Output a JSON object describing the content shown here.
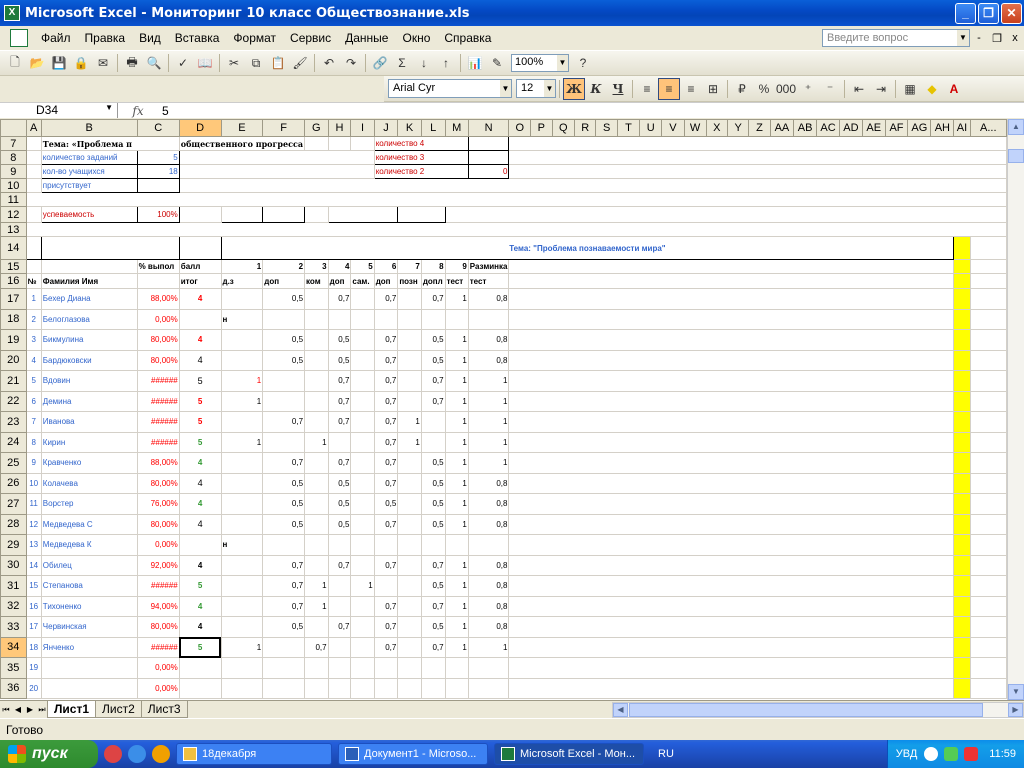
{
  "window": {
    "title": "Microsoft Excel - Мониторинг 10 класс Обществознание.xls",
    "app_icon": "excel-icon",
    "minimize": "_",
    "restore": "❐",
    "close": "✕"
  },
  "menu": {
    "items": [
      "Файл",
      "Правка",
      "Вид",
      "Вставка",
      "Формат",
      "Сервис",
      "Данные",
      "Окно",
      "Справка"
    ],
    "ask_placeholder": "Введите вопрос",
    "mdi_minimize": "-",
    "mdi_restore": "❐",
    "mdi_close": "x"
  },
  "toolbar": {
    "zoom": "100%"
  },
  "format_toolbar": {
    "font": "Arial Cyr",
    "size": "12",
    "bold": "Ж",
    "italic": "К",
    "underline": "Ч",
    "percent": "%",
    "thousands": "000"
  },
  "formula_bar": {
    "cell": "D34",
    "fx": "fx",
    "value": "5"
  },
  "columns": [
    "A",
    "B",
    "C",
    "D",
    "E",
    "F",
    "G",
    "H",
    "I",
    "J",
    "K",
    "L",
    "M",
    "N",
    "O",
    "P",
    "Q",
    "R",
    "S",
    "T",
    "U",
    "V",
    "W",
    "X",
    "Y",
    "Z",
    "AA",
    "AB",
    "AC",
    "AD",
    "AE",
    "AF",
    "AG",
    "AH",
    "AI",
    "A..."
  ],
  "sheet": {
    "topic_label": "Тема: «Проблема п",
    "topic_label_cont": "общественного прогресса",
    "tasks_label": "количество заданий",
    "tasks_value": "5",
    "students_label": "кол-во учащихся",
    "students_value": "18",
    "present_label": "присутствует",
    "count4_label": "количество 4",
    "count3_label": "количество 3",
    "count2_label": "количество 2",
    "count2_value": "0",
    "progress_label": "успеваемость",
    "progress_value": "100%",
    "theme_title": "Тема: \"Проблема познаваемости мира\"",
    "pct_header": "% выпол",
    "score_header": "балл",
    "task_numbers": [
      "1",
      "2",
      "3",
      "4",
      "5",
      "6",
      "7",
      "8",
      "9"
    ],
    "warmup": "Разминка",
    "num_header": "№",
    "name_header": "Фамилия  Имя",
    "total_header": "итог",
    "subheaders": [
      "д.з",
      "доп",
      "ком",
      "доп",
      "сам.",
      "доп",
      "позн",
      "допл",
      "тест",
      "тест"
    ]
  },
  "students": [
    {
      "row": "17",
      "n": "1",
      "name": "Бехер Диана",
      "pct": "88,00%",
      "grade": "4",
      "gclass": "g4",
      "e": "",
      "f": "0,5",
      "g": "",
      "h": "0,7",
      "i": "",
      "j": "0,7",
      "k": "",
      "l": "0,7",
      "m": "1",
      "n2": "0,8"
    },
    {
      "row": "18",
      "n": "2",
      "name": "Белоглазова",
      "pct": "0,00%",
      "grade": "",
      "gclass": "",
      "e": "н",
      "f": "",
      "g": "",
      "h": "",
      "i": "",
      "j": "",
      "k": "",
      "l": "",
      "m": "",
      "n2": ""
    },
    {
      "row": "19",
      "n": "3",
      "name": "Бикмулина",
      "pct": "80,00%",
      "grade": "4",
      "gclass": "g4",
      "e": "",
      "f": "0,5",
      "g": "",
      "h": "0,5",
      "i": "",
      "j": "0,7",
      "k": "",
      "l": "0,5",
      "m": "1",
      "n2": "0,8"
    },
    {
      "row": "20",
      "n": "4",
      "name": "Бардюковски",
      "pct": "80,00%",
      "grade": "4",
      "gclass": "gblack small-grade",
      "e": "",
      "f": "0,5",
      "g": "",
      "h": "0,5",
      "i": "",
      "j": "0,7",
      "k": "",
      "l": "0,5",
      "m": "1",
      "n2": "0,8"
    },
    {
      "row": "21",
      "n": "5",
      "name": "Вдовин",
      "pct": "######",
      "grade": "5",
      "gclass": "gblack small-grade",
      "e": "1",
      "f": "",
      "g": "",
      "h": "0,7",
      "i": "",
      "j": "0,7",
      "k": "",
      "l": "0,7",
      "m": "1",
      "n2": "1"
    },
    {
      "row": "22",
      "n": "6",
      "name": "Демина",
      "pct": "######",
      "grade": "5",
      "gclass": "g4",
      "e": "1",
      "f": "",
      "g": "",
      "h": "0,7",
      "i": "",
      "j": "0,7",
      "k": "",
      "l": "0,7",
      "m": "1",
      "n2": "1"
    },
    {
      "row": "23",
      "n": "7",
      "name": "Иванова",
      "pct": "######",
      "grade": "5",
      "gclass": "g4",
      "e": "",
      "f": "0,7",
      "g": "",
      "h": "0,7",
      "i": "",
      "j": "0,7",
      "k": "1",
      "l": "",
      "m": "1",
      "n2": "1"
    },
    {
      "row": "24",
      "n": "8",
      "name": "Кирин",
      "pct": "######",
      "grade": "5",
      "gclass": "g5",
      "e": "1",
      "f": "",
      "g": "1",
      "h": "",
      "i": "",
      "j": "0,7",
      "k": "1",
      "l": "",
      "m": "1",
      "n2": "1"
    },
    {
      "row": "25",
      "n": "9",
      "name": "Кравченко",
      "pct": "88,00%",
      "grade": "4",
      "gclass": "g5",
      "e": "",
      "f": "0,7",
      "g": "",
      "h": "0,7",
      "i": "",
      "j": "0,7",
      "k": "",
      "l": "0,5",
      "m": "1",
      "n2": "1"
    },
    {
      "row": "26",
      "n": "10",
      "name": "Колачева",
      "pct": "80,00%",
      "grade": "4",
      "gclass": "gblack small-grade",
      "e": "",
      "f": "0,5",
      "g": "",
      "h": "0,5",
      "i": "",
      "j": "0,7",
      "k": "",
      "l": "0,5",
      "m": "1",
      "n2": "0,8"
    },
    {
      "row": "27",
      "n": "11",
      "name": "Ворстер",
      "pct": "76,00%",
      "grade": "4",
      "gclass": "g5",
      "e": "",
      "f": "0,5",
      "g": "",
      "h": "0,5",
      "i": "",
      "j": "0,5",
      "k": "",
      "l": "0,5",
      "m": "1",
      "n2": "0,8"
    },
    {
      "row": "28",
      "n": "12",
      "name": "Медведева С",
      "pct": "80,00%",
      "grade": "4",
      "gclass": "gblack small-grade",
      "e": "",
      "f": "0,5",
      "g": "",
      "h": "0,5",
      "i": "",
      "j": "0,7",
      "k": "",
      "l": "0,5",
      "m": "1",
      "n2": "0,8"
    },
    {
      "row": "29",
      "n": "13",
      "name": "Медведева К",
      "pct": "0,00%",
      "grade": "",
      "gclass": "",
      "e": "н",
      "f": "",
      "g": "",
      "h": "",
      "i": "",
      "j": "",
      "k": "",
      "l": "",
      "m": "",
      "n2": ""
    },
    {
      "row": "30",
      "n": "14",
      "name": "Обилец",
      "pct": "92,00%",
      "grade": "4",
      "gclass": "gblack",
      "e": "",
      "f": "0,7",
      "g": "",
      "h": "0,7",
      "i": "",
      "j": "0,7",
      "k": "",
      "l": "0,7",
      "m": "1",
      "n2": "0,8"
    },
    {
      "row": "31",
      "n": "15",
      "name": "Степанова",
      "pct": "######",
      "grade": "5",
      "gclass": "g5",
      "e": "",
      "f": "0,7",
      "g": "1",
      "h": "",
      "i": "1",
      "j": "",
      "k": "",
      "l": "0,5",
      "m": "1",
      "n2": "0,8"
    },
    {
      "row": "32",
      "n": "16",
      "name": "Тихоненко",
      "pct": "94,00%",
      "grade": "4",
      "gclass": "g5",
      "e": "",
      "f": "0,7",
      "g": "1",
      "h": "",
      "i": "",
      "j": "0,7",
      "k": "",
      "l": "0,7",
      "m": "1",
      "n2": "0,8"
    },
    {
      "row": "33",
      "n": "17",
      "name": "Червинская",
      "pct": "80,00%",
      "grade": "4",
      "gclass": "gblack",
      "e": "",
      "f": "0,5",
      "g": "",
      "h": "0,7",
      "i": "",
      "j": "0,7",
      "k": "",
      "l": "0,5",
      "m": "1",
      "n2": "0,8"
    },
    {
      "row": "34",
      "n": "18",
      "name": "Янченко",
      "pct": "######",
      "grade": "5",
      "gclass": "g5",
      "e": "1",
      "f": "",
      "g": "0,7",
      "h": "",
      "i": "",
      "j": "0,7",
      "k": "",
      "l": "0,7",
      "m": "1",
      "n2": "1"
    },
    {
      "row": "35",
      "n": "19",
      "name": "",
      "pct": "0,00%",
      "grade": "",
      "gclass": "",
      "e": "",
      "f": "",
      "g": "",
      "h": "",
      "i": "",
      "j": "",
      "k": "",
      "l": "",
      "m": "",
      "n2": ""
    },
    {
      "row": "36",
      "n": "20",
      "name": "",
      "pct": "0,00%",
      "grade": "",
      "gclass": "",
      "e": "",
      "f": "",
      "g": "",
      "h": "",
      "i": "",
      "j": "",
      "k": "",
      "l": "",
      "m": "",
      "n2": ""
    }
  ],
  "tabs": {
    "sheets": [
      "Лист1",
      "Лист2",
      "Лист3"
    ],
    "active": "Лист1"
  },
  "status": {
    "text": "Готово"
  },
  "taskbar": {
    "start": "пуск",
    "tasks": [
      "18декабря",
      "Документ1 - Microso...",
      "Microsoft Excel - Мон..."
    ],
    "lang": "RU",
    "indicator": "УВД",
    "time": "11:59"
  }
}
